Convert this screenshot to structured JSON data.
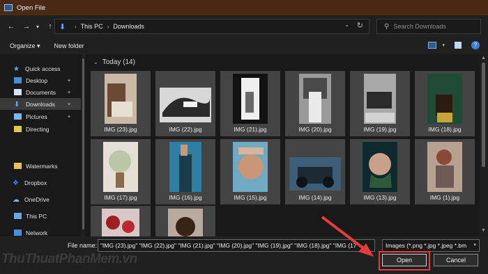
{
  "window": {
    "title": "Open File"
  },
  "address": {
    "crumbs": [
      "This PC",
      "Downloads"
    ]
  },
  "search": {
    "placeholder": "Search Downloads"
  },
  "toolbar": {
    "organize": "Organize ▾",
    "new_folder": "New folder"
  },
  "sidebar": {
    "items": [
      {
        "label": "Quick access",
        "icon": "star-icon"
      },
      {
        "label": "Desktop",
        "icon": "desktop-icon",
        "pinned": true
      },
      {
        "label": "Documents",
        "icon": "documents-icon",
        "pinned": true
      },
      {
        "label": "Downloads",
        "icon": "download-icon",
        "pinned": true,
        "selected": true
      },
      {
        "label": "Pictures",
        "icon": "pictures-icon",
        "pinned": true
      },
      {
        "label": "Directing",
        "icon": "folder-icon"
      },
      {
        "label": "Watermarks",
        "icon": "folder-icon"
      },
      {
        "label": "Dropbox",
        "icon": "dropbox-icon"
      },
      {
        "label": "OneDrive",
        "icon": "cloud-icon"
      },
      {
        "label": "This PC",
        "icon": "computer-icon"
      },
      {
        "label": "Network",
        "icon": "network-icon"
      }
    ]
  },
  "content": {
    "group": "Today (14)",
    "files": [
      "IMG (23).jpg",
      "IMG (22).jpg",
      "IMG (21).jpg",
      "IMG (20).jpg",
      "IMG (19).jpg",
      "IMG (18).jpg",
      "IMG (17).jpg",
      "IMG (16).jpg",
      "IMG (15).jpg",
      "IMG (14).jpg",
      "IMG (13).jpg",
      "IMG (1).jpg",
      "",
      ""
    ]
  },
  "bottom": {
    "filename_label": "File name:",
    "filename_value": "\"IMG (23).jpg\" \"IMG (22).jpg\" \"IMG (21).jpg\" \"IMG (20).jpg\" \"IMG (19).jpg\" \"IMG (18).jpg\" \"IMG (17",
    "filter": "Images (*.png *.jpg *.jpeg *.bm",
    "open_label": "Open",
    "cancel_label": "Cancel"
  },
  "colors": {
    "highlight": "#e63b3b",
    "accent": "#5aa9ff"
  }
}
